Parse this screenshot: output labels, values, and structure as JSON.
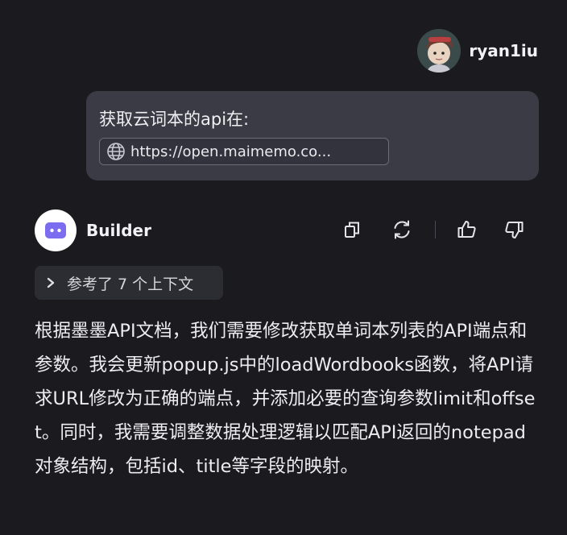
{
  "user": {
    "name": "ryan1iu"
  },
  "user_message": {
    "text": "获取云词本的api在:",
    "link_text": "https://open.maimemo.co..."
  },
  "bot": {
    "name": "Builder",
    "actions": [
      "copy-icon",
      "regenerate-icon",
      "thumbs-up-icon",
      "thumbs-down-icon"
    ]
  },
  "context": {
    "label": "参考了 7 个上下文"
  },
  "response": {
    "text": "根据墨墨API文档，我们需要修改获取单词本列表的API端点和参数。我会更新popup.js中的loadWordbooks函数，将API请求URL修改为正确的端点，并添加必要的查询参数limit和offset。同时，我需要调整数据处理逻辑以匹配API返回的notepad对象结构，包括id、title等字段的映射。"
  },
  "colors": {
    "background": "#1b1b1f",
    "bubble": "#3a3b45",
    "chip": "#2c2d33",
    "bot_accent": "#7b6cf0"
  }
}
